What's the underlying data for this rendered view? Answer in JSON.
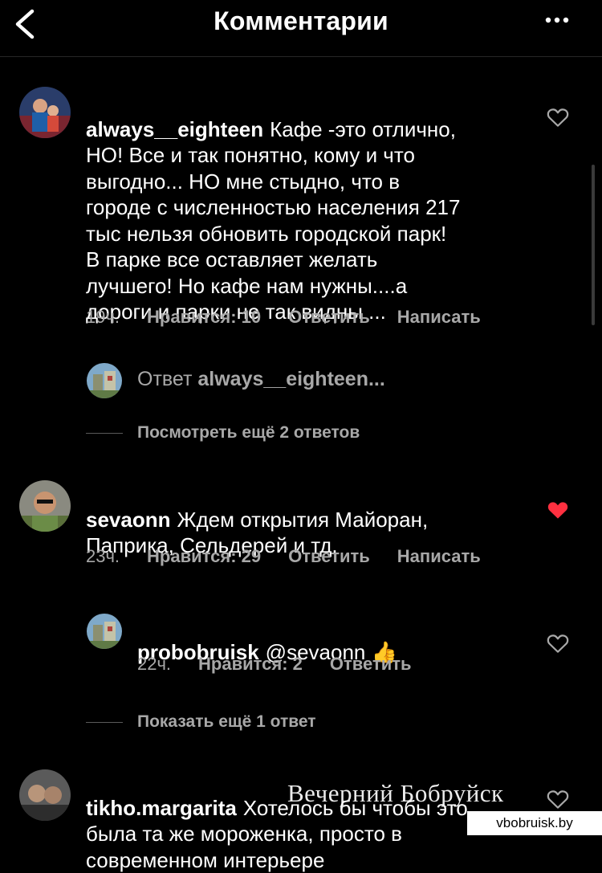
{
  "header": {
    "title": "Комментарии",
    "back_icon": "chevron-left-icon",
    "more_icon": "more-dots-icon"
  },
  "comments": [
    {
      "username": "always__eighteen",
      "text": "Кафе -это отлично,\nНО!  Все и так понятно, кому и что\nвыгодно... НО мне стыдно, что в\nгороде с численностью населения 217\nтыс нельзя обновить городской парк!\nВ парке все оставляет желать\nлучшего! Но кафе нам нужны....а\nдороги и парки не так видны ...",
      "time": "19ч.",
      "likes": "Нравится: 10",
      "reply": "Ответить",
      "message": "Написать",
      "liked": false
    },
    {
      "username": "sevaonn",
      "text": "Ждем открытия Майоран,\nПаприка, Сельдерей и тд.",
      "time": "23ч.",
      "likes": "Нравится: 29",
      "reply": "Ответить",
      "message": "Написать",
      "liked": true
    },
    {
      "username": "tikho.margarita",
      "text": "Хотелось бы чтобы это\nбыла та же мороженка, просто в\nсовременном интерьере",
      "liked": false
    }
  ],
  "reply_preview": {
    "prefix": "Ответ",
    "username": "always__eighteen..."
  },
  "view_more_replies": "Посмотреть ещё 2 ответов",
  "reply": {
    "username": "probobruisk",
    "text": "@sevaonn",
    "emoji": "👍",
    "time": "22ч.",
    "likes": "Нравится: 2",
    "reply": "Ответить",
    "liked": false
  },
  "show_more_replies": "Показать ещё 1 ответ",
  "watermark": {
    "title": "Вечерний Бобруйск",
    "site": "vbobruisk.by"
  },
  "colors": {
    "background": "#000000",
    "text": "#ffffff",
    "secondary": "#a8a8a8",
    "heart_liked": "#ff3040"
  }
}
